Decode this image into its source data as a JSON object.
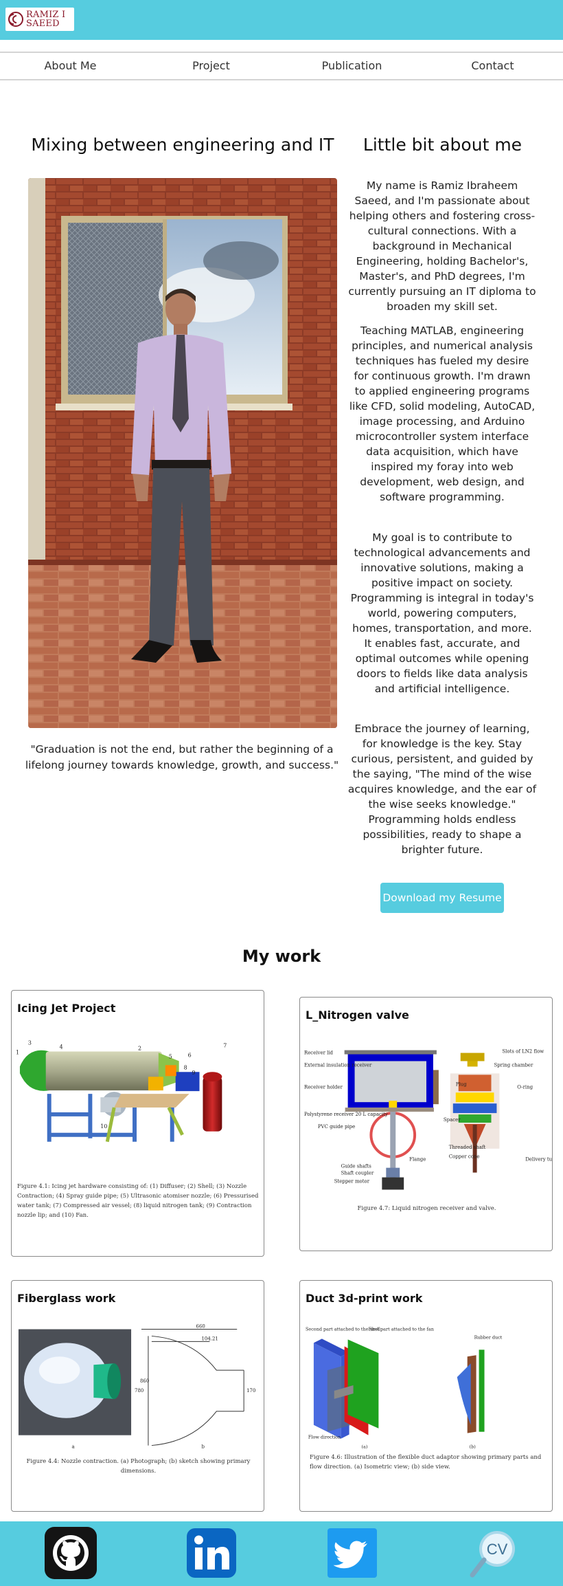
{
  "header": {
    "logo_line1": "RAMIZ I",
    "logo_line2": "SAEED",
    "brand_color": "#8b1a2b",
    "accent_color": "#56ccdf"
  },
  "nav": {
    "items": [
      {
        "label": "About Me"
      },
      {
        "label": "Project"
      },
      {
        "label": "Publication"
      },
      {
        "label": "Contact"
      }
    ]
  },
  "hero": {
    "title": "Mixing between engineering and IT",
    "quote": "\"Graduation is not the end, but rather the beginning of a lifelong journey towards knowledge, growth, and success.\""
  },
  "about": {
    "title": "Little bit about me",
    "paragraphs": [
      "My name is Ramiz Ibraheem Saeed, and I'm passionate about helping others and fostering cross-cultural connections. With a background in Mechanical Engineering, holding Bachelor's, Master's, and PhD degrees, I'm currently pursuing an IT diploma to broaden my skill set.",
      "Teaching MATLAB, engineering principles, and numerical analysis techniques has fueled my desire for continuous growth. I'm drawn to applied engineering programs like CFD, solid modeling, AutoCAD, image processing, and Arduino microcontroller system interface data acquisition, which have inspired my foray into web development, web design, and software programming.",
      "My goal is to contribute to technological advancements and innovative solutions, making a positive impact on society. Programming is integral in today's world, powering computers, homes, transportation, and more. It enables fast, accurate, and optimal outcomes while opening doors to fields like data analysis and artificial intelligence.",
      "Embrace the journey of learning, for knowledge is the key. Stay curious, persistent, and guided by the saying, \"The mind of the wise acquires knowledge, and the ear of the wise seeks knowledge.\" Programming holds endless possibilities, ready to shape a brighter future."
    ],
    "resume_button": "Download my Resume"
  },
  "work": {
    "title": "My work",
    "cards": [
      {
        "title": "Icing Jet Project",
        "caption": "Figure 4.1: Icing jet hardware consisting of: (1) Diffuser; (2) Shell; (3) Nozzle Contraction; (4) Spray guide pipe; (5) Ultrasonic atomiser nozzle; (6) Pressurised water tank; (7) Compressed air vessel; (8) liquid nitrogen tank; (9) Contraction nozzle lip; and (10) Fan.",
        "callouts": [
          "1",
          "2",
          "3",
          "4",
          "5",
          "6",
          "7",
          "8",
          "9",
          "10"
        ]
      },
      {
        "title": "L_Nitrogen valve",
        "caption": "Figure 4.7: Liquid nitrogen receiver and valve.",
        "labels_left": [
          "Receiver lid",
          "External insulation receiver",
          "Receiver holder",
          "Polystyrene receiver 20 L capacity",
          "PVC guide pipe",
          "Guide shafts",
          "Shaft coupler",
          "Stepper motor"
        ],
        "labels_right": [
          "Slots of LN2 flow",
          "Spring chamber",
          "Plug",
          "O-ring",
          "Spacer",
          "Threaded shaft",
          "Copper cone",
          "Delivery tube"
        ],
        "label_flange": "Flange"
      },
      {
        "title": "Fiberglass work",
        "caption": "Figure 4.4: Nozzle contraction. (a) Photograph; (b) sketch showing primary dimensions.",
        "dims": [
          "660",
          "104.21",
          "860",
          "780",
          "170"
        ],
        "sub_a": "a",
        "sub_b": "b"
      },
      {
        "title": "Duct 3d-print work",
        "caption": "Figure 4.6: Illustration of the flexible duct adaptor showing primary parts and flow direction. (a) Isometric view; (b) side view.",
        "labels": [
          "Second part attached to the shell",
          "First part attached to the fan",
          "Rubber duct",
          "Flow direction"
        ],
        "sub_a": "(a)",
        "sub_b": "(b)"
      }
    ]
  },
  "footer": {
    "icons": [
      "github-icon",
      "linkedin-icon",
      "twitter-icon",
      "cv-icon"
    ],
    "cv_text": "CV"
  }
}
